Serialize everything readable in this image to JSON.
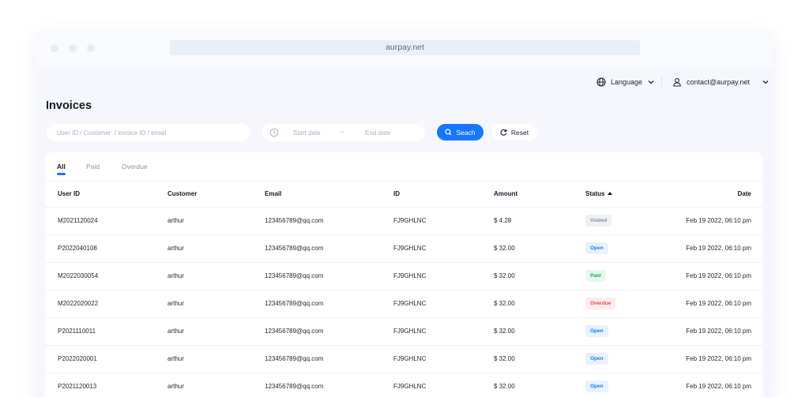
{
  "browser": {
    "url": "aurpay.net"
  },
  "topnav": {
    "language": "Language",
    "account": "contact@aurpay.net"
  },
  "page": {
    "title": "Invoices"
  },
  "filters": {
    "search_placeholder": "User ID / Customer  / invoice ID / email",
    "start_placeholder": "Start date",
    "date_separator": "~",
    "end_placeholder": "End date",
    "search_label": "Seach",
    "reset_label": "Reset"
  },
  "tabs": [
    {
      "label": "All",
      "active": true
    },
    {
      "label": "Paid",
      "active": false
    },
    {
      "label": "Overdue",
      "active": false
    }
  ],
  "table": {
    "columns": [
      "User ID",
      "Customer",
      "Email",
      "ID",
      "Amount",
      "Status",
      "Date"
    ],
    "rows": [
      {
        "user_id": "M2021120024",
        "customer": "arthur",
        "email": "123456789@qq.com",
        "id": "FJ9GHLNC",
        "amount": "$ 4.28",
        "status": "Voided",
        "date": "Feb 19 2022, 06:10 pm"
      },
      {
        "user_id": "P2022040108",
        "customer": "arthur",
        "email": "123456789@qq.com",
        "id": "FJ9GHLNC",
        "amount": "$ 32.00",
        "status": "Open",
        "date": "Feb 19 2022, 06:10 pm"
      },
      {
        "user_id": "M2022030054",
        "customer": "arthur",
        "email": "123456789@qq.com",
        "id": "FJ9GHLNC",
        "amount": "$ 32.00",
        "status": "Paid",
        "date": "Feb 19 2022, 06:10 pm"
      },
      {
        "user_id": "M2022020022",
        "customer": "arthur",
        "email": "123456789@qq.com",
        "id": "FJ9GHLNC",
        "amount": "$ 32.00",
        "status": "Overdue",
        "date": "Feb 19 2022, 06:10 pm"
      },
      {
        "user_id": "P2021110011",
        "customer": "arthur",
        "email": "123456789@qq.com",
        "id": "FJ9GHLNC",
        "amount": "$ 32.00",
        "status": "Open",
        "date": "Feb 19 2022, 06:10 pm"
      },
      {
        "user_id": "P2022020001",
        "customer": "arthur",
        "email": "123456789@qq.com",
        "id": "FJ9GHLNC",
        "amount": "$ 32.00",
        "status": "Open",
        "date": "Feb 19 2022, 06:10 pm"
      },
      {
        "user_id": "P2021120013",
        "customer": "arthur",
        "email": "123456789@qq.com",
        "id": "FJ9GHLNC",
        "amount": "$ 32.00",
        "status": "Open",
        "date": "Feb 19 2022, 06:10 pm"
      }
    ]
  },
  "colors": {
    "accent": "#1677ff",
    "open": "#1677ff",
    "paid": "#26a35b",
    "overdue": "#e5484d",
    "voided": "#8a92a3"
  },
  "icons": {
    "language": "globe-icon",
    "account": "user-icon",
    "date": "clock-icon",
    "search": "search-icon",
    "reset": "refresh-icon",
    "dropdown": "chevron-down-icon",
    "sort": "sort-up-icon"
  }
}
